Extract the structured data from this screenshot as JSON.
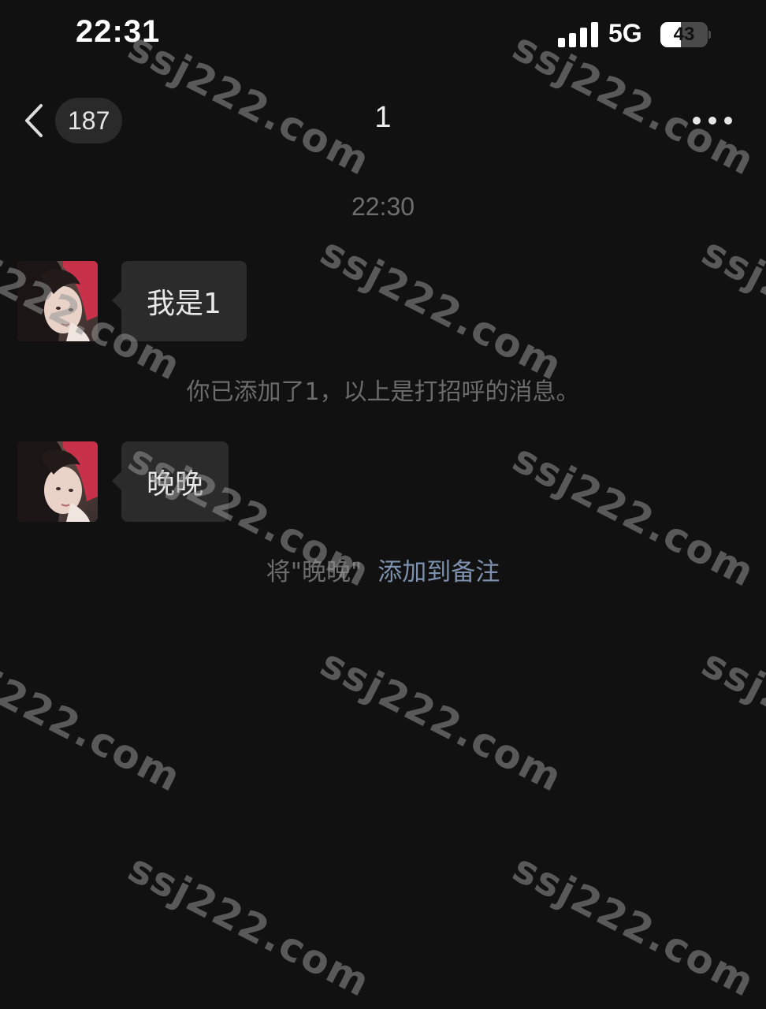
{
  "status_bar": {
    "time": "22:31",
    "network": "5G",
    "battery_level": "43",
    "battery_fraction": 0.43
  },
  "nav": {
    "back_icon": "chevron-left-icon",
    "unread_count": "187",
    "title": "1",
    "more_icon": "more-dots-icon"
  },
  "chat": {
    "timestamp": "22:30",
    "messages": [
      {
        "text": "我是1"
      },
      {
        "text": "晚晚"
      }
    ],
    "system_notice": "你已添加了1，以上是打招呼的消息。",
    "remark_hint": {
      "prefix": "将\"晚晚\"",
      "link": "添加到备注"
    }
  },
  "watermark": {
    "text": "ssj222.com"
  },
  "colors": {
    "background": "#111111",
    "bubble": "#2b2b2b",
    "link": "#7d90ad"
  }
}
